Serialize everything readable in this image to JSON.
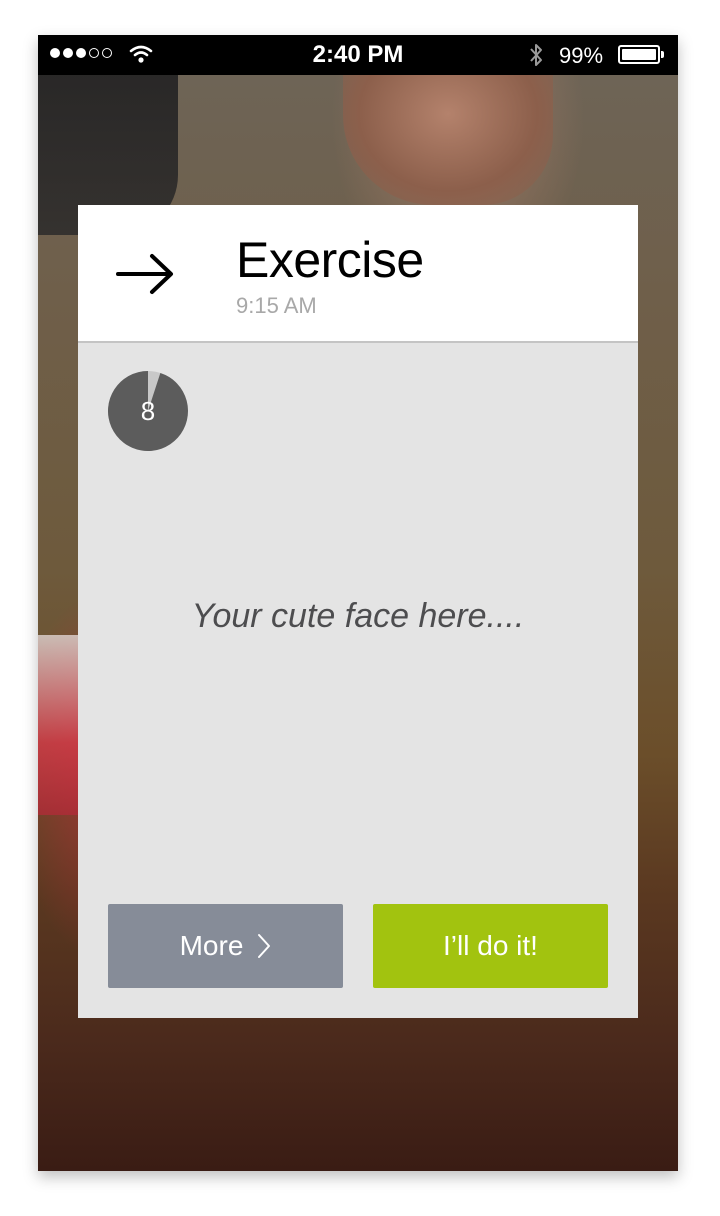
{
  "status_bar": {
    "signal_filled": 3,
    "signal_total": 5,
    "time": "2:40 PM",
    "battery_percent": "99%",
    "battery_level": 0.99
  },
  "card": {
    "icon": "arrow-right-icon",
    "title": "Exercise",
    "time": "9:15 AM",
    "timer_value": "8",
    "timer_remaining_fraction": 0.95,
    "placeholder": "Your cute face here....",
    "more_label": "More",
    "more_icon": "chevron-right-icon",
    "do_label": "I’ll do it!"
  },
  "colors": {
    "more_button": "#868c98",
    "do_button": "#a2c30f",
    "timer": "#5c5c5c"
  }
}
